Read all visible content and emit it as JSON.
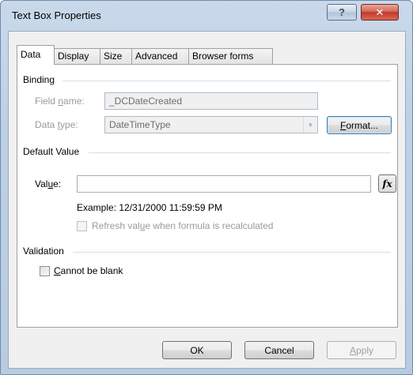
{
  "window": {
    "title": "Text Box Properties"
  },
  "titlebar": {
    "help_icon": "question-mark-icon",
    "help_glyph": "?",
    "close_icon": "close-x-icon",
    "close_glyph": "✕"
  },
  "tabs": [
    {
      "label": "Data",
      "active": true
    },
    {
      "label": "Display",
      "active": false
    },
    {
      "label": "Size",
      "active": false
    },
    {
      "label": "Advanced",
      "active": false
    },
    {
      "label": "Browser forms",
      "active": false
    }
  ],
  "binding": {
    "group_label": "Binding",
    "field_name": {
      "label_pre": "Field ",
      "label_u": "n",
      "label_post": "ame:",
      "value": "_DCDateCreated",
      "enabled": false
    },
    "data_type": {
      "label_pre": "Data ",
      "label_u": "t",
      "label_post": "ype:",
      "value": "DateTimeType",
      "enabled": false,
      "arrow_icon": "dropdown-arrow-icon",
      "arrow_glyph": "▼"
    },
    "format_button": {
      "label_u": "F",
      "label_rest": "ormat..."
    }
  },
  "default_value": {
    "group_label": "Default Value",
    "value": {
      "label_pre": "Val",
      "label_u": "u",
      "label_post": "e:",
      "value": ""
    },
    "fx_button": {
      "icon": "formula-fx-icon",
      "label": "fx"
    },
    "example": "Example: 12/31/2000 11:59:59 PM",
    "refresh": {
      "label_pre": "Refresh val",
      "label_u": "u",
      "label_post": "e when formula is recalculated",
      "checked": false,
      "enabled": false
    }
  },
  "validation": {
    "group_label": "Validation",
    "cannot_be_blank": {
      "label_u": "C",
      "label_rest": "annot be blank",
      "checked": false
    }
  },
  "footer": {
    "ok": "OK",
    "cancel": "Cancel",
    "apply_u": "A",
    "apply_rest": "pply"
  },
  "colors": {
    "title_bar": "#bcd0e6",
    "close_button": "#c2382a",
    "dialog_bg": "#f0f0f0",
    "focus_border": "#3c7fb1"
  }
}
